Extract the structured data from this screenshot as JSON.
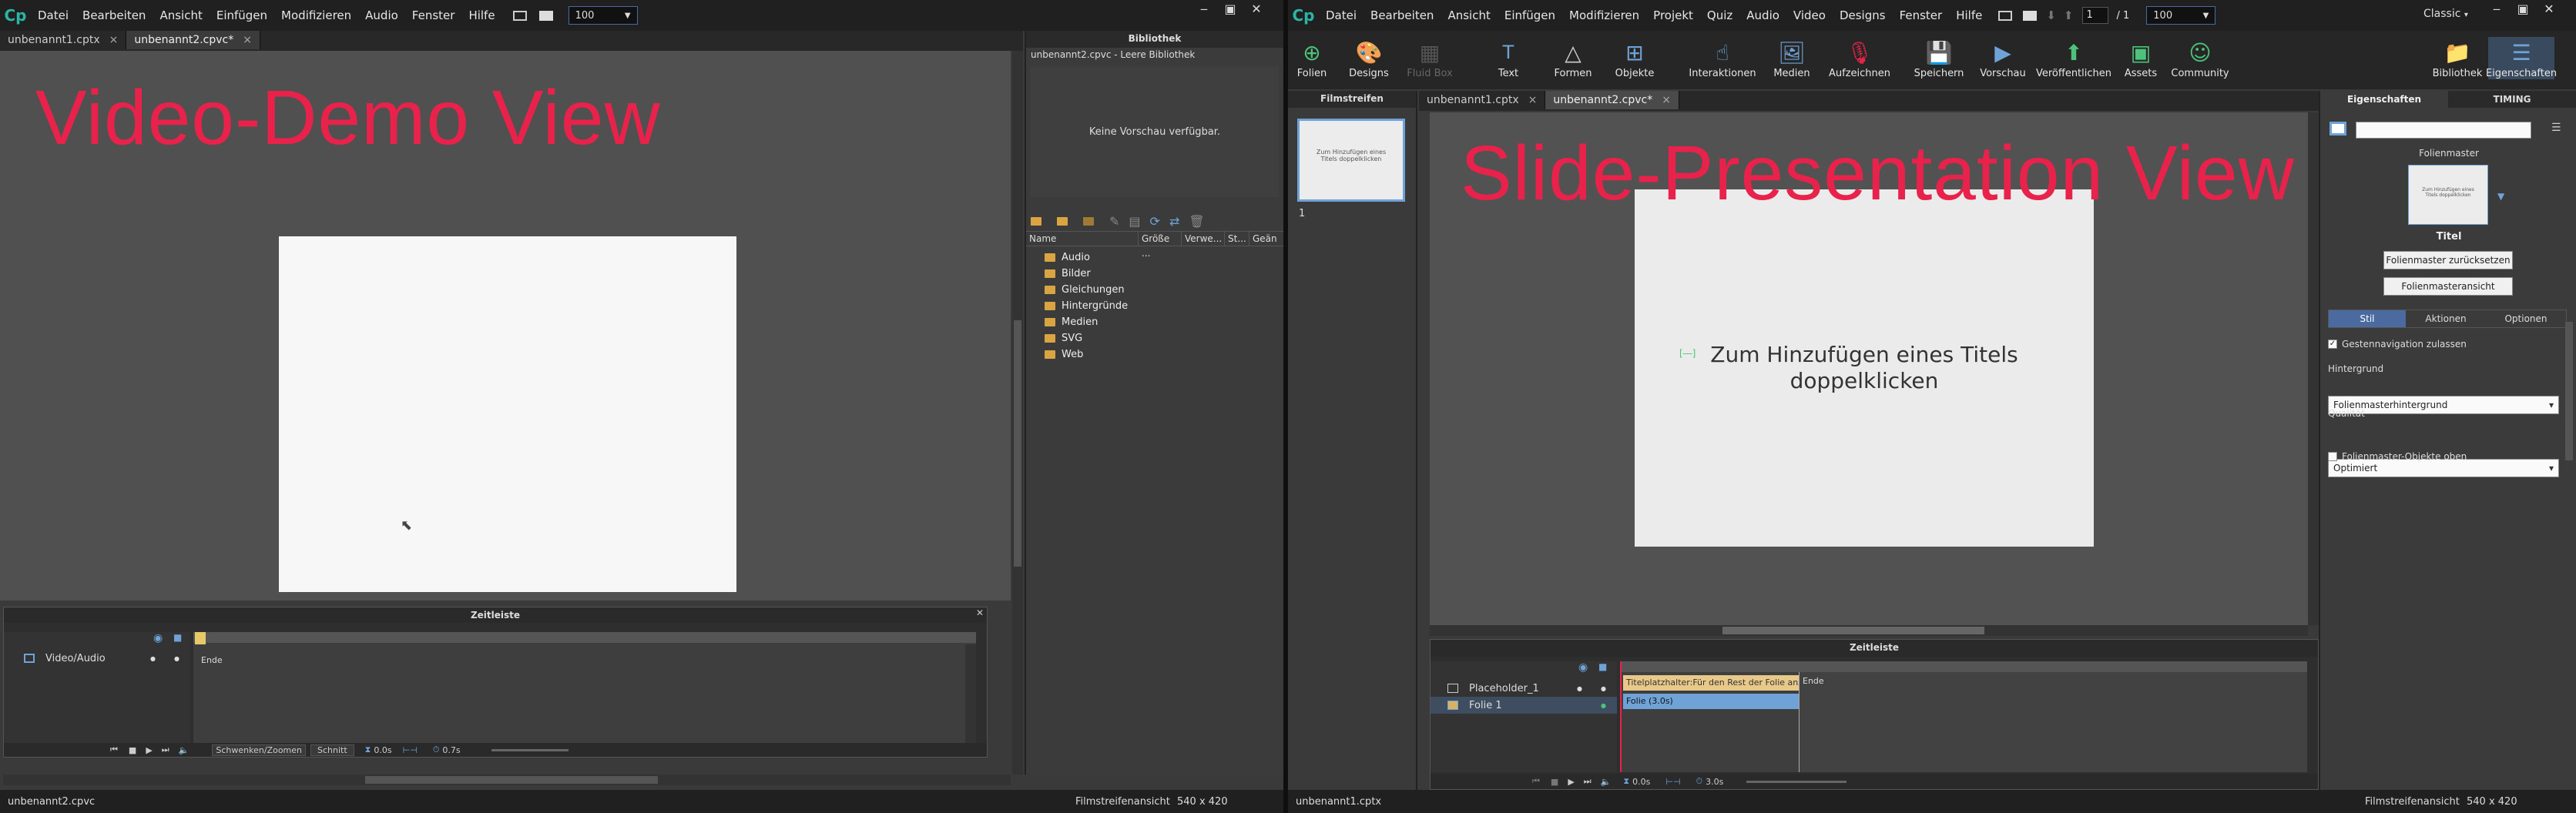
{
  "left": {
    "app_logo": "Cp",
    "menu": [
      "Datei",
      "Bearbeiten",
      "Ansicht",
      "Einfügen",
      "Modifizieren",
      "Audio",
      "Fenster",
      "Hilfe"
    ],
    "zoom": "100",
    "tabs": [
      {
        "label": "unbenannt1.cptx",
        "close": "×"
      },
      {
        "label": "unbenannt2.cpvc*",
        "close": "×"
      }
    ],
    "overlay_title": "Video-Demo View",
    "library": {
      "title": "Bibliothek",
      "doc": "unbenannt2.cpvc - Leere Bibliothek",
      "no_preview": "Keine Vorschau verfügbar.",
      "columns": [
        "Name",
        "Größe ...",
        "Verwe...",
        "St...",
        "Geän"
      ],
      "folders": [
        "Audio",
        "Bilder",
        "Gleichungen",
        "Hintergründe",
        "Medien",
        "SVG",
        "Web"
      ]
    },
    "timeline": {
      "title": "Zeitleiste",
      "track": "Video/Audio",
      "end": "Ende",
      "tabs": [
        "Schwenken/Zoomen",
        "Schnitt"
      ],
      "time1": "0.0s",
      "time2": "0.7s"
    },
    "status": {
      "file": "unbenannt2.cpvc",
      "view": "Filmstreifenansicht",
      "size": "540 x 420"
    }
  },
  "right": {
    "app_logo": "Cp",
    "menu": [
      "Datei",
      "Bearbeiten",
      "Ansicht",
      "Einfügen",
      "Modifizieren",
      "Projekt",
      "Quiz",
      "Audio",
      "Video",
      "Designs",
      "Fenster",
      "Hilfe"
    ],
    "page_current": "1",
    "page_total": "/  1",
    "zoom": "100",
    "mode": "Classic",
    "toolbar": [
      "Folien",
      "Designs",
      "Fluid Box",
      "Text",
      "Formen",
      "Objekte",
      "Interaktionen",
      "Medien",
      "Aufzeichnen",
      "Speichern",
      "Vorschau",
      "Veröffentlichen",
      "Assets",
      "Community",
      "Bibliothek",
      "Eigenschaften"
    ],
    "filmstrip_title": "Filmstreifen",
    "thumb_text": "Zum Hinzufügen eines Titels doppelklicken",
    "slide_number": "1",
    "tabs": [
      {
        "label": "unbenannt1.cptx",
        "close": "×"
      },
      {
        "label": "unbenannt2.cpvc*",
        "close": "×"
      }
    ],
    "overlay_title": "Slide-Presentation View",
    "slide_placeholder": "Zum Hinzufügen eines Titels doppelklicken",
    "props": {
      "tab_props": "Eigenschaften",
      "tab_timing": "TIMING",
      "master_label": "Folienmaster",
      "master_thumb_text": "Zum Hinzufügen eines Titels doppelklicken",
      "master_name": "Titel",
      "btn_reset": "Folienmaster zurücksetzen",
      "btn_view": "Folienmasteransicht",
      "subtabs": [
        "Stil",
        "Aktionen",
        "Optionen"
      ],
      "gesture": "Gestennavigation zulassen",
      "bg_label": "Hintergrund",
      "bg_value": "Folienmasterhintergrund",
      "quality_label": "Qualität",
      "quality_value": "Optimiert",
      "master_top": "Folienmaster-Objekte oben"
    },
    "timeline": {
      "title": "Zeitleiste",
      "rows": [
        "Placeholder_1",
        "Folie 1"
      ],
      "placeholder_bar": "Titelplatzhalter:Für den Rest der Folie anze...",
      "slide_bar": "Folie (3.0s)",
      "end": "Ende",
      "time1": "0.0s",
      "time2": "3.0s"
    },
    "status": {
      "file": "unbenannt1.cptx",
      "view": "Filmstreifenansicht",
      "size": "540 x 420"
    }
  },
  "colors": {
    "accent": "#e8224a",
    "brand": "#2ab5a4",
    "timeline_blue": "#6fa3d8",
    "bar_tan": "#e8c98a"
  }
}
